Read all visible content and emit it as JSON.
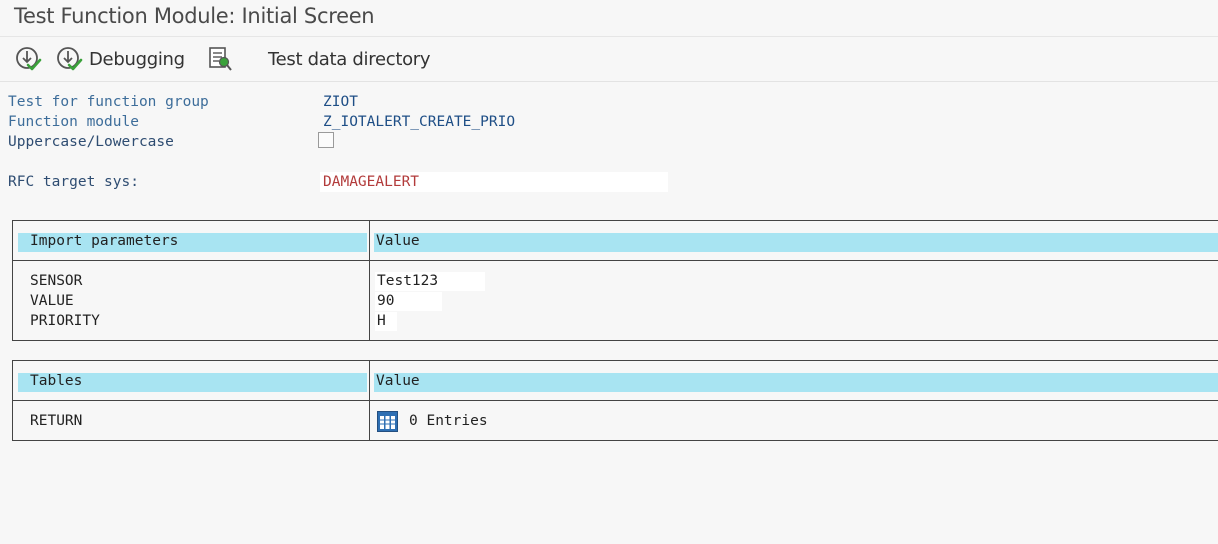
{
  "window": {
    "title": "Test Function Module: Initial Screen"
  },
  "toolbar": {
    "execute_icon": "execute-icon",
    "debugging_label": "Debugging",
    "test_sequences_icon": "test-sequences-icon",
    "test_data_label": "Test data directory"
  },
  "header": {
    "function_group_label": "Test for function group",
    "function_group_value": "ZIOT",
    "function_module_label": "Function module",
    "function_module_value": "Z_IOTALERT_CREATE_PRIO",
    "case_label": "Uppercase/Lowercase",
    "case_checked": false,
    "rfc_label": "RFC target sys:",
    "rfc_value": "DAMAGEALERT"
  },
  "import_params": {
    "col1": "Import parameters",
    "col2": "Value",
    "rows": [
      {
        "name": "SENSOR",
        "value": "Test123"
      },
      {
        "name": "VALUE",
        "value": "90"
      },
      {
        "name": "PRIORITY",
        "value": "H"
      }
    ]
  },
  "tables": {
    "col1": "Tables",
    "col2": "Value",
    "rows": [
      {
        "name": "RETURN",
        "icon": "table-icon",
        "value": "0 Entries"
      }
    ]
  },
  "colors": {
    "header_bg": "#a8e4f2",
    "label_blue": "#3d6d9a",
    "rfc_red": "#b23b3b"
  }
}
